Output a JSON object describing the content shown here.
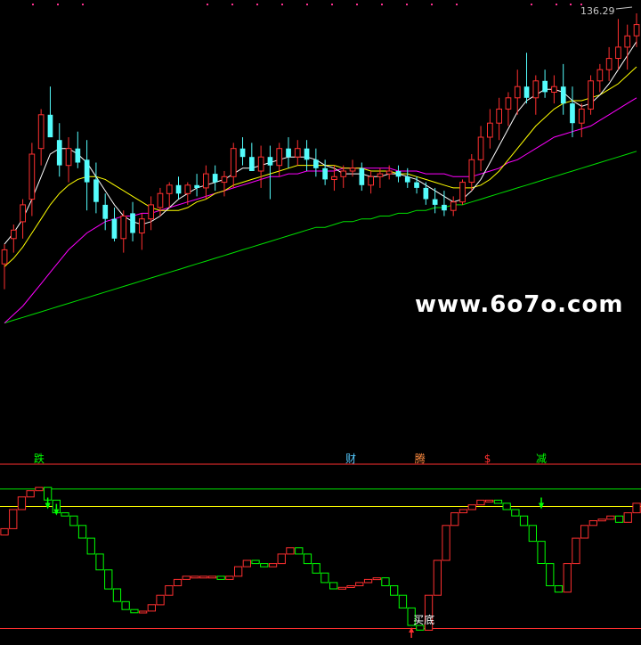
{
  "chart_data": [
    {
      "type": "candlestick",
      "price_label": "136.29",
      "ylim": [
        15,
        140
      ],
      "watermark": "www.6o7o.com",
      "colors": {
        "up": "#ff3030",
        "down": "#54fcfc",
        "ma_short": "#ffffff",
        "ma_mid": "#ffff00",
        "ma_long": "#ff00ff",
        "ma_longest": "#00e000"
      },
      "candles": [
        {
          "o": 51,
          "h": 58,
          "l": 42,
          "c": 56
        },
        {
          "o": 60,
          "h": 65,
          "l": 55,
          "c": 63
        },
        {
          "o": 66,
          "h": 74,
          "l": 60,
          "c": 72
        },
        {
          "o": 74,
          "h": 94,
          "l": 68,
          "c": 90
        },
        {
          "o": 92,
          "h": 106,
          "l": 86,
          "c": 104
        },
        {
          "o": 104,
          "h": 114,
          "l": 98,
          "c": 96
        },
        {
          "o": 95,
          "h": 101,
          "l": 82,
          "c": 86
        },
        {
          "o": 86,
          "h": 96,
          "l": 80,
          "c": 92
        },
        {
          "o": 92,
          "h": 98,
          "l": 85,
          "c": 87
        },
        {
          "o": 88,
          "h": 95,
          "l": 70,
          "c": 80
        },
        {
          "o": 81,
          "h": 87,
          "l": 69,
          "c": 73
        },
        {
          "o": 72,
          "h": 76,
          "l": 63,
          "c": 67
        },
        {
          "o": 67,
          "h": 71,
          "l": 59,
          "c": 60
        },
        {
          "o": 60,
          "h": 70,
          "l": 55,
          "c": 68
        },
        {
          "o": 69,
          "h": 73,
          "l": 59,
          "c": 62
        },
        {
          "o": 62,
          "h": 69,
          "l": 56,
          "c": 67
        },
        {
          "o": 67,
          "h": 75,
          "l": 63,
          "c": 72
        },
        {
          "o": 71,
          "h": 78,
          "l": 68,
          "c": 76
        },
        {
          "o": 76,
          "h": 80,
          "l": 71,
          "c": 79
        },
        {
          "o": 79,
          "h": 82,
          "l": 74,
          "c": 76
        },
        {
          "o": 76,
          "h": 80,
          "l": 72,
          "c": 79
        },
        {
          "o": 79,
          "h": 83,
          "l": 75,
          "c": 78
        },
        {
          "o": 78,
          "h": 86,
          "l": 74,
          "c": 83
        },
        {
          "o": 83,
          "h": 86,
          "l": 77,
          "c": 80
        },
        {
          "o": 80,
          "h": 84,
          "l": 75,
          "c": 82
        },
        {
          "o": 82,
          "h": 94,
          "l": 78,
          "c": 92
        },
        {
          "o": 92,
          "h": 96,
          "l": 86,
          "c": 89
        },
        {
          "o": 89,
          "h": 94,
          "l": 84,
          "c": 84
        },
        {
          "o": 84,
          "h": 93,
          "l": 78,
          "c": 89
        },
        {
          "o": 89,
          "h": 93,
          "l": 74,
          "c": 86
        },
        {
          "o": 86,
          "h": 94,
          "l": 82,
          "c": 92
        },
        {
          "o": 92,
          "h": 96,
          "l": 85,
          "c": 89
        },
        {
          "o": 89,
          "h": 95,
          "l": 86,
          "c": 92
        },
        {
          "o": 92,
          "h": 95,
          "l": 84,
          "c": 88
        },
        {
          "o": 88,
          "h": 92,
          "l": 82,
          "c": 85
        },
        {
          "o": 85,
          "h": 88,
          "l": 79,
          "c": 81
        },
        {
          "o": 81,
          "h": 86,
          "l": 77,
          "c": 82
        },
        {
          "o": 82,
          "h": 86,
          "l": 78,
          "c": 84
        },
        {
          "o": 84,
          "h": 88,
          "l": 82,
          "c": 85
        },
        {
          "o": 85,
          "h": 87,
          "l": 77,
          "c": 79
        },
        {
          "o": 79,
          "h": 84,
          "l": 76,
          "c": 82
        },
        {
          "o": 82,
          "h": 85,
          "l": 78,
          "c": 83
        },
        {
          "o": 83,
          "h": 86,
          "l": 81,
          "c": 84
        },
        {
          "o": 84,
          "h": 86,
          "l": 80,
          "c": 82
        },
        {
          "o": 82,
          "h": 85,
          "l": 78,
          "c": 80
        },
        {
          "o": 80,
          "h": 82,
          "l": 76,
          "c": 78
        },
        {
          "o": 78,
          "h": 80,
          "l": 72,
          "c": 74
        },
        {
          "o": 74,
          "h": 78,
          "l": 69,
          "c": 72
        },
        {
          "o": 72,
          "h": 77,
          "l": 68,
          "c": 70
        },
        {
          "o": 70,
          "h": 75,
          "l": 68,
          "c": 73
        },
        {
          "o": 73,
          "h": 81,
          "l": 72,
          "c": 80
        },
        {
          "o": 80,
          "h": 90,
          "l": 77,
          "c": 88
        },
        {
          "o": 88,
          "h": 100,
          "l": 84,
          "c": 96
        },
        {
          "o": 96,
          "h": 106,
          "l": 92,
          "c": 101
        },
        {
          "o": 101,
          "h": 110,
          "l": 95,
          "c": 106
        },
        {
          "o": 106,
          "h": 112,
          "l": 100,
          "c": 110
        },
        {
          "o": 110,
          "h": 120,
          "l": 104,
          "c": 114
        },
        {
          "o": 114,
          "h": 126,
          "l": 108,
          "c": 110
        },
        {
          "o": 110,
          "h": 118,
          "l": 104,
          "c": 116
        },
        {
          "o": 116,
          "h": 120,
          "l": 110,
          "c": 112
        },
        {
          "o": 112,
          "h": 118,
          "l": 108,
          "c": 114
        },
        {
          "o": 114,
          "h": 122,
          "l": 104,
          "c": 108
        },
        {
          "o": 108,
          "h": 114,
          "l": 96,
          "c": 101
        },
        {
          "o": 101,
          "h": 108,
          "l": 96,
          "c": 106
        },
        {
          "o": 106,
          "h": 118,
          "l": 104,
          "c": 116
        },
        {
          "o": 116,
          "h": 122,
          "l": 112,
          "c": 120
        },
        {
          "o": 120,
          "h": 128,
          "l": 116,
          "c": 124
        },
        {
          "o": 124,
          "h": 138,
          "l": 120,
          "c": 128
        },
        {
          "o": 128,
          "h": 136,
          "l": 120,
          "c": 132
        },
        {
          "o": 132,
          "h": 140,
          "l": 128,
          "c": 136
        }
      ],
      "ma_short": [
        58,
        62,
        67,
        74,
        82,
        90,
        92,
        92,
        90,
        87,
        82,
        77,
        72,
        68,
        66,
        65,
        66,
        68,
        71,
        74,
        76,
        78,
        79,
        80,
        81,
        83,
        85,
        85,
        86,
        87,
        88,
        89,
        89,
        89,
        88,
        86,
        85,
        83,
        83,
        83,
        82,
        82,
        83,
        83,
        82,
        81,
        79,
        77,
        75,
        73,
        74,
        77,
        81,
        87,
        93,
        99,
        105,
        109,
        111,
        113,
        113,
        112,
        109,
        107,
        108,
        111,
        115,
        120,
        125,
        130
      ],
      "ma_mid": [
        50,
        53,
        57,
        62,
        67,
        72,
        76,
        79,
        81,
        82,
        82,
        81,
        79,
        77,
        75,
        73,
        71,
        70,
        70,
        70,
        71,
        73,
        74,
        76,
        77,
        79,
        80,
        81,
        82,
        83,
        84,
        85,
        86,
        86,
        86,
        86,
        86,
        85,
        85,
        85,
        84,
        84,
        84,
        83,
        83,
        82,
        81,
        80,
        79,
        78,
        78,
        78,
        79,
        81,
        84,
        88,
        92,
        96,
        100,
        103,
        106,
        108,
        109,
        109,
        110,
        111,
        113,
        115,
        118,
        121
      ],
      "ma_long": [
        30,
        33,
        36,
        40,
        44,
        48,
        52,
        56,
        59,
        62,
        64,
        66,
        67,
        68,
        68,
        69,
        69,
        70,
        71,
        72,
        73,
        74,
        75,
        76,
        77,
        78,
        79,
        80,
        81,
        82,
        82,
        83,
        83,
        84,
        84,
        84,
        84,
        85,
        85,
        85,
        85,
        85,
        85,
        84,
        84,
        84,
        83,
        83,
        83,
        82,
        82,
        82,
        83,
        84,
        85,
        87,
        88,
        90,
        92,
        94,
        96,
        97,
        98,
        99,
        100,
        102,
        104,
        106,
        108,
        110
      ],
      "ma_longest": [
        30,
        31,
        32,
        33,
        34,
        35,
        36,
        37,
        38,
        39,
        40,
        41,
        42,
        43,
        44,
        45,
        46,
        47,
        48,
        49,
        50,
        51,
        52,
        53,
        54,
        55,
        56,
        57,
        58,
        59,
        60,
        61,
        62,
        63,
        64,
        64,
        65,
        66,
        66,
        67,
        67,
        68,
        68,
        69,
        69,
        70,
        70,
        71,
        71,
        72,
        72,
        73,
        74,
        75,
        76,
        77,
        78,
        79,
        80,
        81,
        82,
        83,
        84,
        85,
        86,
        87,
        88,
        89,
        90,
        91
      ]
    },
    {
      "type": "indicator",
      "ylim": [
        0,
        100
      ],
      "upper_line": 95,
      "mid_line": 84,
      "lower_line": 7,
      "colors": {
        "upper": "#00dd00",
        "mid": "#ffff00",
        "lower": "#ff3030",
        "up": "#ff3030",
        "down": "#00ff00",
        "flat": "#ff3030"
      },
      "signals": [
        {
          "label": "跌",
          "index": 4,
          "color": "#00ff00"
        },
        {
          "label": "财",
          "index": 40,
          "color": "#54c8fc"
        },
        {
          "label": "腾",
          "index": 48,
          "color": "#ff8c40"
        },
        {
          "label": "$",
          "index": 56,
          "color": "#ff3030"
        },
        {
          "label": "减",
          "index": 62,
          "color": "#00ff00"
        }
      ],
      "buy_label": "买底",
      "buy_index": 47,
      "values": [
        70,
        82,
        90,
        94,
        96,
        88,
        80,
        78,
        72,
        64,
        54,
        44,
        32,
        24,
        19,
        17,
        18,
        22,
        28,
        34,
        38,
        40,
        40,
        40,
        40,
        38,
        40,
        46,
        50,
        48,
        46,
        48,
        54,
        58,
        54,
        48,
        42,
        36,
        32,
        33,
        34,
        36,
        38,
        39,
        34,
        28,
        20,
        9,
        6,
        28,
        50,
        72,
        80,
        82,
        85,
        88,
        88,
        86,
        82,
        78,
        72,
        62,
        48,
        34,
        30,
        48,
        64,
        72,
        75,
        76,
        78,
        74,
        80,
        86
      ]
    }
  ]
}
